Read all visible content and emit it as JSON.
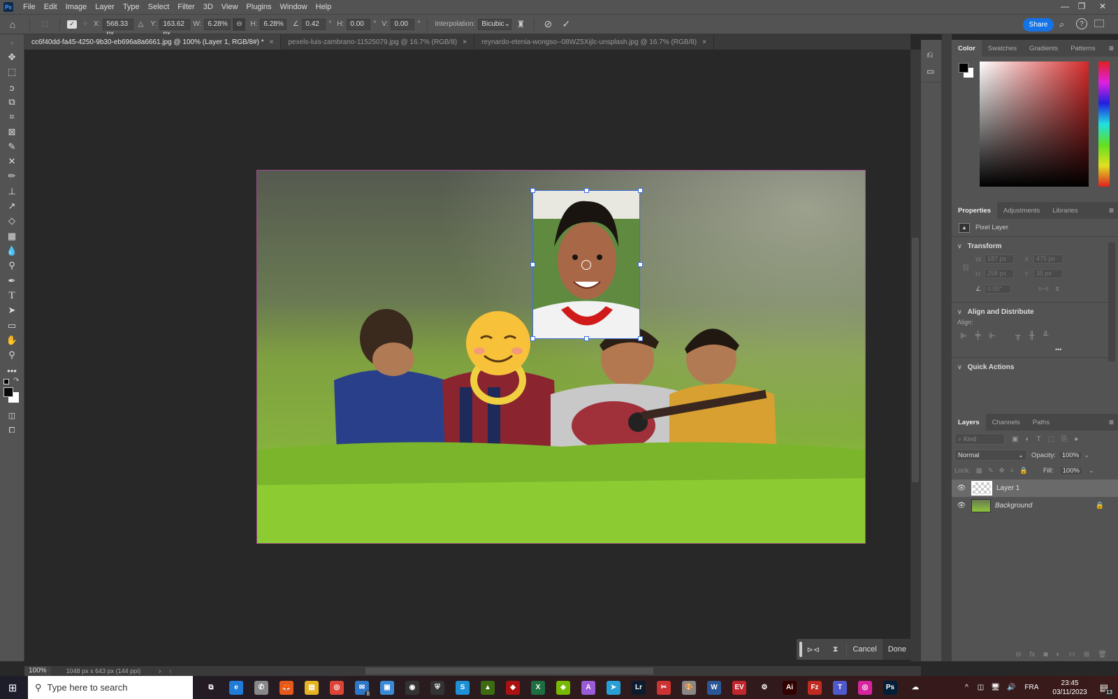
{
  "app": {
    "logo": "Ps"
  },
  "menu": [
    "File",
    "Edit",
    "Image",
    "Layer",
    "Type",
    "Select",
    "Filter",
    "3D",
    "View",
    "Plugins",
    "Window",
    "Help"
  ],
  "window_controls": {
    "minimize": "—",
    "restore": "❐",
    "close": "✕"
  },
  "options": {
    "x_label": "X:",
    "x_value": "568.33 px",
    "y_label": "Y:",
    "y_value": "163.62 px",
    "w_label": "W:",
    "w_value": "6.28%",
    "h_label": "H:",
    "h_value": "6.28%",
    "angle_value": "0.42",
    "deg": "°",
    "hskew_label": "H:",
    "hskew_value": "0.00",
    "vskew_label": "V:",
    "vskew_value": "0.00",
    "interp_label": "Interpolation:",
    "interp_value": "Bicubic",
    "share_label": "Share"
  },
  "tabs": [
    {
      "label": "cc6f40dd-fa45-4250-9b30-eb696a8a6661.jpg @ 100% (Layer 1, RGB/8#) *",
      "close": "×",
      "active": true
    },
    {
      "label": "pexels-luis-zambrano-11525079.jpg @ 16.7% (RGB/8)",
      "close": "×",
      "active": false
    },
    {
      "label": "reynardo-etenia-wongso--08WZ5Xijlc-unsplash.jpg @ 16.7% (RGB/8)",
      "close": "×",
      "active": false
    }
  ],
  "tools": [
    "move",
    "marquee",
    "lasso",
    "object-select",
    "crop",
    "frame",
    "eyedropper",
    "healing",
    "brush",
    "stamp",
    "history-brush",
    "eraser",
    "gradient",
    "blur",
    "dodge",
    "pen",
    "type",
    "path-select",
    "rectangle",
    "hand",
    "zoom",
    "more"
  ],
  "colors": {
    "foreground": "#000000",
    "background": "#ffffff",
    "accent": "#1473e6"
  },
  "color_panel": {
    "tabs": [
      "Color",
      "Swatches",
      "Gradients",
      "Patterns"
    ],
    "hue": "#d42a2a"
  },
  "properties": {
    "tabs": [
      "Properties",
      "Adjustments",
      "Libraries"
    ],
    "layer_type": "Pixel Layer",
    "transform": {
      "title": "Transform",
      "w_label": "W",
      "w": "187 px",
      "x_label": "X",
      "x": "475 px",
      "h_label": "H",
      "h": "258 px",
      "y_label": "Y",
      "y": "35 px",
      "angle": "0.00°"
    },
    "align": {
      "title": "Align and Distribute",
      "align_label": "Align:",
      "more": "•••"
    },
    "quick_actions": {
      "title": "Quick Actions"
    }
  },
  "layers_panel": {
    "tabs": [
      "Layers",
      "Channels",
      "Paths"
    ],
    "kind_placeholder": "Kind",
    "blend_mode": "Normal",
    "opacity_label": "Opacity:",
    "opacity": "100%",
    "lock_label": "Lock:",
    "fill_label": "Fill:",
    "fill": "100%",
    "layers": [
      {
        "name": "Layer 1",
        "visible": true,
        "selected": true
      },
      {
        "name": "Background",
        "visible": true,
        "locked": true
      }
    ]
  },
  "status": {
    "zoom": "100%",
    "doc_info": "1048 px x 643 px (144 ppi)"
  },
  "float_bar": {
    "cancel": "Cancel",
    "done": "Done"
  },
  "taskbar": {
    "search_placeholder": "Type here to search",
    "apps": [
      {
        "name": "task-view",
        "label": "⧉",
        "color": "transparent"
      },
      {
        "name": "edge",
        "label": "e",
        "color": "#1f7bd6"
      },
      {
        "name": "whatsapp",
        "label": "✆",
        "color": "#888"
      },
      {
        "name": "firefox",
        "label": "🦊",
        "color": "#e8581c"
      },
      {
        "name": "file-explorer",
        "label": "▤",
        "color": "#e6b422"
      },
      {
        "name": "chrome",
        "label": "◎",
        "color": "#db4437"
      },
      {
        "name": "mail",
        "label": "✉",
        "color": "#2f78c9",
        "badge": "8"
      },
      {
        "name": "app-blue",
        "label": "▣",
        "color": "#3a8ad6"
      },
      {
        "name": "app-circle",
        "label": "◉",
        "color": "#333"
      },
      {
        "name": "security",
        "label": "⛨",
        "color": "#333"
      },
      {
        "name": "skype",
        "label": "S",
        "color": "#1e90d6"
      },
      {
        "name": "nvidia",
        "label": "▲",
        "color": "#3d6b12"
      },
      {
        "name": "app-red",
        "label": "◆",
        "color": "#a11"
      },
      {
        "name": "excel",
        "label": "X",
        "color": "#1d6f42"
      },
      {
        "name": "nvidia-geforce",
        "label": "◈",
        "color": "#76b900"
      },
      {
        "name": "affinity",
        "label": "A",
        "color": "#9a5bd6"
      },
      {
        "name": "telegram",
        "label": "➤",
        "color": "#2a9fd6"
      },
      {
        "name": "lightroom",
        "label": "Lr",
        "color": "#0d1b2e"
      },
      {
        "name": "snipping",
        "label": "✂",
        "color": "#c33"
      },
      {
        "name": "paint",
        "label": "🎨",
        "color": "#888"
      },
      {
        "name": "word",
        "label": "W",
        "color": "#2b5797"
      },
      {
        "name": "expressvpn",
        "label": "EV",
        "color": "#c0262d"
      },
      {
        "name": "settings",
        "label": "⚙",
        "color": "transparent"
      },
      {
        "name": "illustrator",
        "label": "Ai",
        "color": "#330000"
      },
      {
        "name": "filezilla",
        "label": "Fz",
        "color": "#bf2b23"
      },
      {
        "name": "teams",
        "label": "T",
        "color": "#5059c9"
      },
      {
        "name": "instagram",
        "label": "◎",
        "color": "#d6249f"
      },
      {
        "name": "photoshop",
        "label": "Ps",
        "color": "#001e36"
      },
      {
        "name": "weather",
        "label": "☁",
        "color": "transparent"
      }
    ],
    "tray": {
      "chevron": "^",
      "lang": "FRA",
      "time": "23:45",
      "date": "03/11/2023",
      "notifications": "13"
    }
  }
}
